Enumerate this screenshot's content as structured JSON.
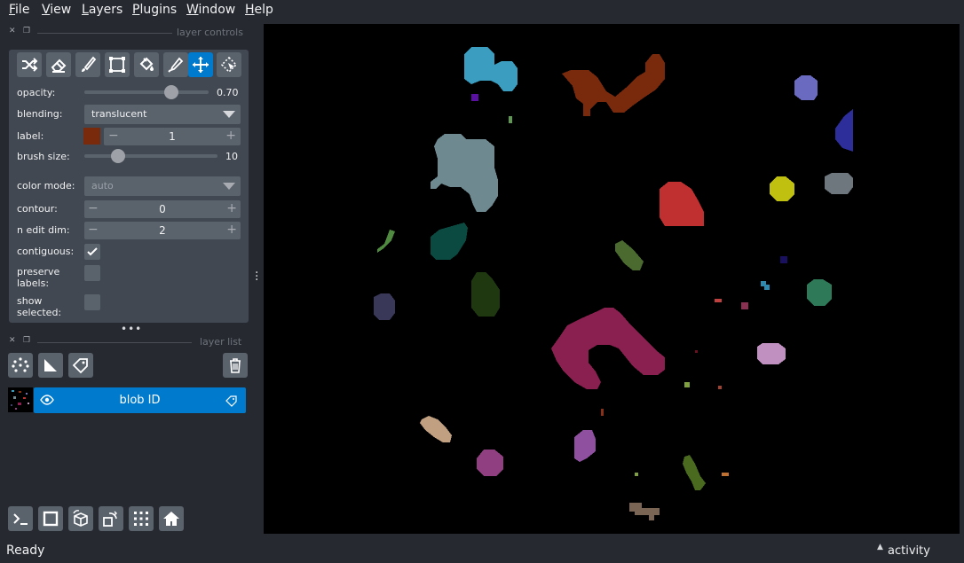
{
  "menu": [
    "File",
    "View",
    "Layers",
    "Plugins",
    "Window",
    "Help"
  ],
  "menu_mnemonic": [
    "F",
    "V",
    "L",
    "P",
    "W",
    "H"
  ],
  "layer_controls": {
    "header": "layer controls",
    "tools": [
      "shuffle-icon",
      "eraser-icon",
      "paintbrush-icon",
      "transform-icon",
      "fill-bucket-icon",
      "color-picker-icon",
      "pan-zoom-icon",
      "select-icon"
    ],
    "active_tool": "pan-zoom-icon",
    "opacity_label": "opacity:",
    "opacity_value": "0.70",
    "opacity_fraction": 0.7,
    "blending_label": "blending:",
    "blending_value": "translucent",
    "label_label": "label:",
    "label_value": "1",
    "label_color": "#7a2a0c",
    "brush_size_label": "brush size:",
    "brush_size_value": "10",
    "brush_size_fraction": 0.25,
    "color_mode_label": "color mode:",
    "color_mode_value": "auto",
    "contour_label": "contour:",
    "contour_value": "0",
    "n_edit_dim_label": "n edit dim:",
    "n_edit_dim_value": "2",
    "contiguous_label": "contiguous:",
    "contiguous_checked": true,
    "preserve_labels_label_1": "preserve",
    "preserve_labels_label_2": "labels:",
    "preserve_labels_checked": false,
    "show_selected_label_1": "show",
    "show_selected_label_2": "selected:",
    "show_selected_checked": false
  },
  "layer_list": {
    "header": "layer list",
    "buttons": [
      "new-points-layer-icon",
      "new-shapes-layer-icon",
      "new-labels-layer-icon"
    ],
    "delete_button": "delete-layer-icon",
    "layers": [
      {
        "name": "blob ID",
        "visible": true,
        "type": "labels",
        "selected": true
      }
    ]
  },
  "bottom_buttons": [
    "console-icon",
    "toggle-2d-3d-icon",
    "roll-dims-icon",
    "transpose-icon",
    "grid-mode-icon",
    "home-icon"
  ],
  "status": {
    "text": "Ready",
    "activity": "activity"
  },
  "colors": {
    "background": "#262930",
    "panel": "#414851",
    "button": "#5a626c",
    "accent": "#007acc",
    "canvas": "#000000"
  }
}
